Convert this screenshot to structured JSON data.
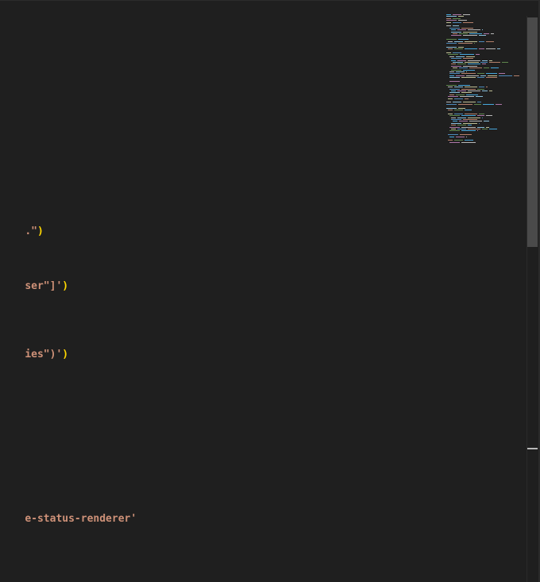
{
  "editor": {
    "lines": [
      {
        "str": ".\"",
        "close": ")"
      },
      {
        "str": "ser\"]'",
        "close": ")"
      },
      {
        "str": "ies\")'",
        "close": ")"
      },
      {
        "str": "e-status-renderer'",
        "close": ""
      }
    ]
  },
  "colors": {
    "background": "#1f1f1f",
    "string": "#ce9178",
    "bracket": "#ffd700",
    "scrollbar_thumb": "#4a4a4a"
  }
}
